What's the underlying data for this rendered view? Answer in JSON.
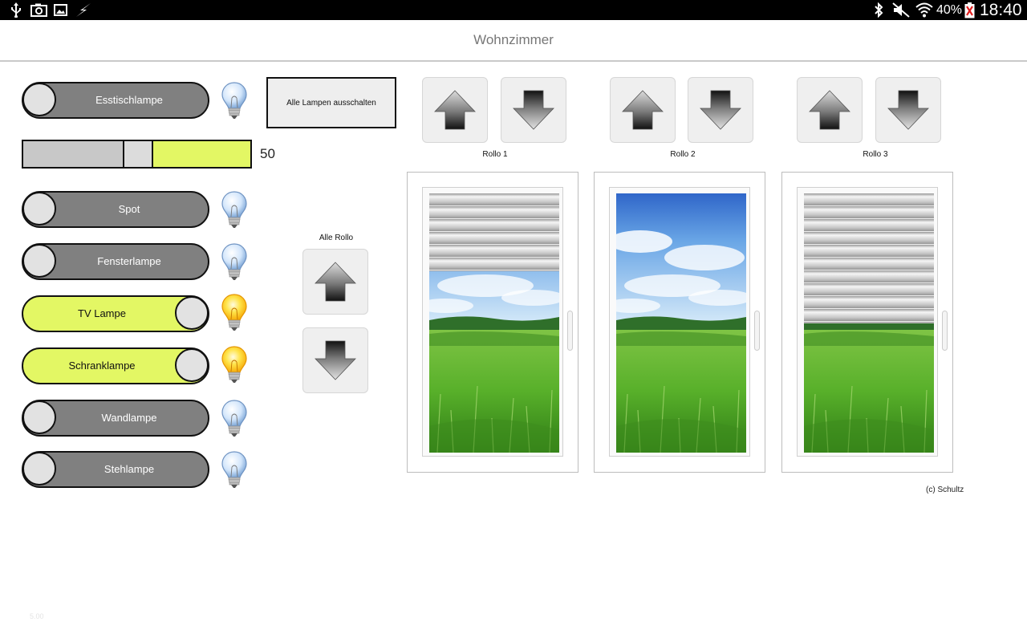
{
  "status_bar": {
    "left_icons": [
      "usb-icon",
      "camera-icon",
      "gallery-icon",
      "flash-icon"
    ],
    "right_icons": [
      "bluetooth-icon",
      "mute-icon",
      "wifi-icon"
    ],
    "battery": "40%",
    "time": "18:40"
  },
  "header": {
    "title": "Wohnzimmer"
  },
  "lamps": [
    {
      "label": "Esstischlampe",
      "on": false
    },
    {
      "label": "Spot",
      "on": false
    },
    {
      "label": "Fensterlampe",
      "on": false
    },
    {
      "label": "TV Lampe",
      "on": true
    },
    {
      "label": "Schranklampe",
      "on": true
    },
    {
      "label": "Wandlampe",
      "on": false
    },
    {
      "label": "Stehlampe",
      "on": false
    }
  ],
  "dimmer": {
    "value": "50",
    "level": 0.5
  },
  "all_lamps_off_label": "Alle Lampen ausschalten",
  "all_rollo": {
    "label": "Alle Rollo"
  },
  "rollos": [
    {
      "label": "Rollo 1",
      "closed_fraction": 0.3
    },
    {
      "label": "Rollo 2",
      "closed_fraction": 0.0
    },
    {
      "label": "Rollo 3",
      "closed_fraction": 0.5
    }
  ],
  "copyright": "(c) Schultz",
  "version": "5.00",
  "colors": {
    "toggle_on": "#e3f764",
    "toggle_off": "#808080",
    "status_bar": "#000000"
  }
}
